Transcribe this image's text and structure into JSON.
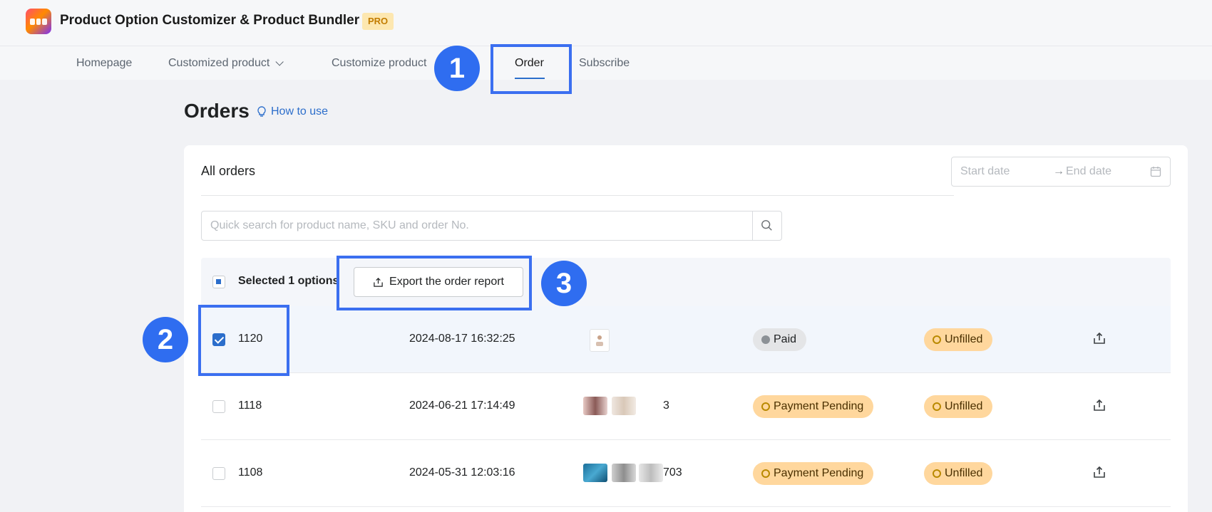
{
  "app": {
    "title": "Product Option Customizer & Product Bundler",
    "badge": "PRO"
  },
  "nav": {
    "items": [
      {
        "label": "Homepage"
      },
      {
        "label": "Customized product"
      },
      {
        "label": "Customize product"
      },
      {
        "label": "Order"
      },
      {
        "label": "Subscribe"
      }
    ],
    "active": "Order"
  },
  "page": {
    "title": "Orders",
    "how_to": "How to use"
  },
  "card": {
    "heading": "All orders",
    "date_start_placeholder": "Start date",
    "date_arrow": "→",
    "date_end_placeholder": "End date",
    "search_placeholder": "Quick search for product name, SKU and order No."
  },
  "bulk": {
    "selected_text": "Selected 1 options",
    "export_label": "Export the order report"
  },
  "orders": [
    {
      "id": "1120",
      "date": "2024-08-17 16:32:25",
      "qty": "",
      "payment": "Paid",
      "fulfillment": "Unfilled",
      "selected": true
    },
    {
      "id": "1118",
      "date": "2024-06-21 17:14:49",
      "qty": "3",
      "payment": "Payment Pending",
      "fulfillment": "Unfilled",
      "selected": false
    },
    {
      "id": "1108",
      "date": "2024-05-31 12:03:16",
      "qty": "703",
      "payment": "Payment Pending",
      "fulfillment": "Unfilled",
      "selected": false
    }
  ],
  "annotations": {
    "m1": "1",
    "m2": "2",
    "m3": "3"
  },
  "colors": {
    "accent": "#2c6ecb",
    "highlight": "#3b6ff0",
    "warning_bg": "#ffd79d",
    "neutral_bg": "#e4e5e7"
  }
}
